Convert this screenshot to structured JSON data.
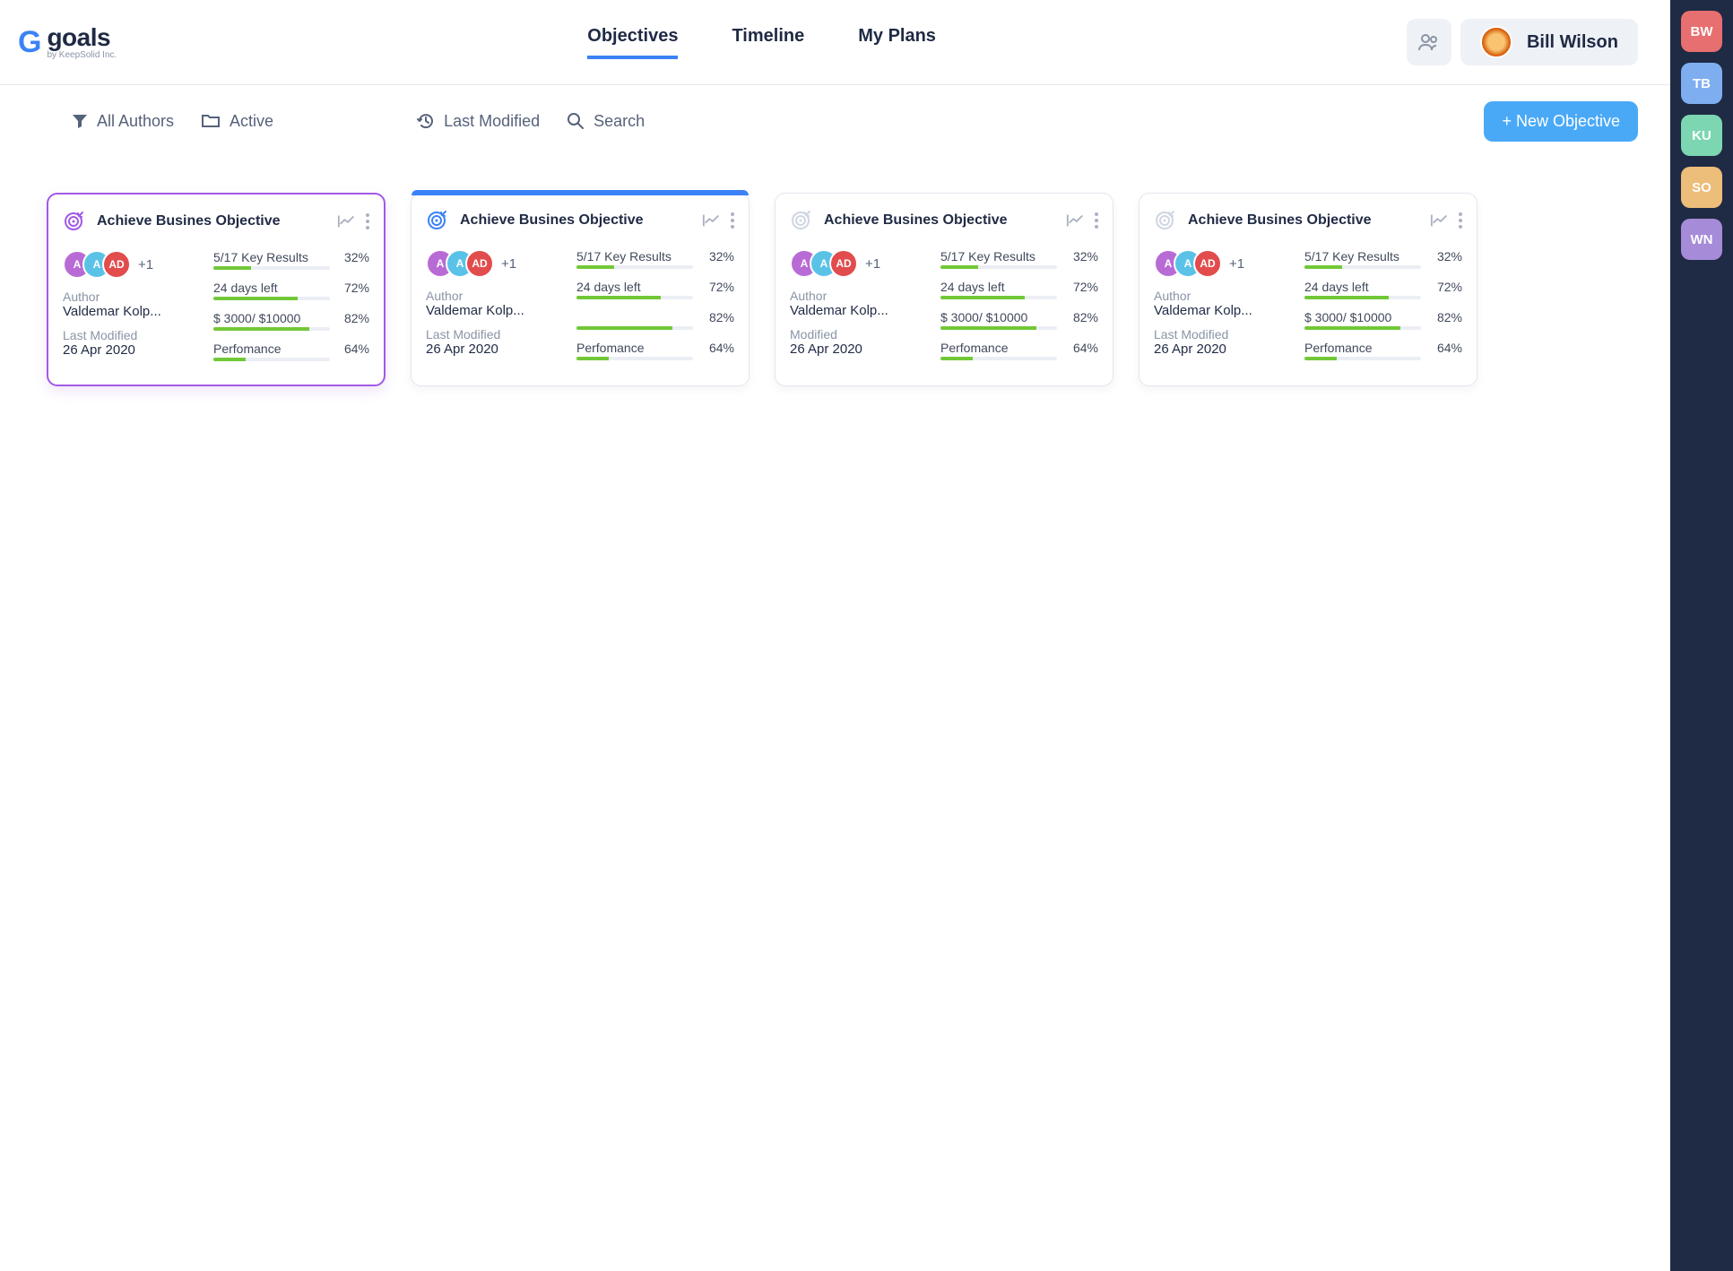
{
  "app": {
    "name": "goals",
    "tagline": "by KeepSolid Inc."
  },
  "nav": {
    "objectives": "Objectives",
    "timeline": "Timeline",
    "myplans": "My Plans"
  },
  "user": {
    "name": "Bill Wilson"
  },
  "toolbar": {
    "all_authors": "All Authors",
    "active": "Active",
    "last_modified": "Last Modified",
    "search": "Search",
    "new_btn": "+ New Objective"
  },
  "rail": [
    {
      "initials": "BW",
      "color": "chip-red"
    },
    {
      "initials": "TB",
      "color": "chip-blue"
    },
    {
      "initials": "KU",
      "color": "chip-green"
    },
    {
      "initials": "SO",
      "color": "chip-orange"
    },
    {
      "initials": "WN",
      "color": "chip-purple"
    }
  ],
  "cards": [
    {
      "variant": "sel",
      "accent": "#a259e6",
      "title": "Achieve Busines Objective",
      "plus": "+1",
      "author_label": "Author",
      "author_value": "Valdemar Kolp...",
      "modified_label": "Last Modified",
      "modified_value": "26 Apr 2020",
      "metrics": [
        {
          "label": "5/17 Key Results",
          "pct": "32%",
          "fill": 32
        },
        {
          "label": "24 days left",
          "pct": "72%",
          "fill": 72
        },
        {
          "label": "$ 3000/ $10000",
          "pct": "82%",
          "fill": 82
        },
        {
          "label": "Perfomance",
          "pct": "64%",
          "fill": 28
        }
      ]
    },
    {
      "variant": "blue",
      "accent": "#3b82f6",
      "title": "Achieve Busines Objective",
      "plus": "+1",
      "author_label": "Author",
      "author_value": "Valdemar Kolp...",
      "modified_label": "Last Modified",
      "modified_value": "26 Apr 2020",
      "metrics": [
        {
          "label": "5/17 Key Results",
          "pct": "32%",
          "fill": 32
        },
        {
          "label": "24 days left",
          "pct": "72%",
          "fill": 72
        },
        {
          "label": "",
          "pct": "82%",
          "fill": 82
        },
        {
          "label": "Perfomance",
          "pct": "64%",
          "fill": 28
        }
      ]
    },
    {
      "variant": "",
      "accent": "#cfd6e2",
      "title": "Achieve Busines Objective",
      "plus": "+1",
      "author_label": "Author",
      "author_value": "Valdemar Kolp...",
      "modified_label": "Modified",
      "modified_value": "26 Apr 2020",
      "metrics": [
        {
          "label": "5/17 Key Results",
          "pct": "32%",
          "fill": 32
        },
        {
          "label": "24 days left",
          "pct": "72%",
          "fill": 72
        },
        {
          "label": "$ 3000/ $10000",
          "pct": "82%",
          "fill": 82
        },
        {
          "label": "Perfomance",
          "pct": "64%",
          "fill": 28
        }
      ]
    },
    {
      "variant": "",
      "accent": "#cfd6e2",
      "title": "Achieve Busines Objective",
      "plus": "+1",
      "author_label": "Author",
      "author_value": "Valdemar Kolp...",
      "modified_label": "Last Modified",
      "modified_value": "26 Apr 2020",
      "metrics": [
        {
          "label": "5/17 Key Results",
          "pct": "32%",
          "fill": 32
        },
        {
          "label": "24 days left",
          "pct": "72%",
          "fill": 72
        },
        {
          "label": "$ 3000/ $10000",
          "pct": "82%",
          "fill": 82
        },
        {
          "label": "Perfomance",
          "pct": "64%",
          "fill": 28
        }
      ]
    }
  ]
}
